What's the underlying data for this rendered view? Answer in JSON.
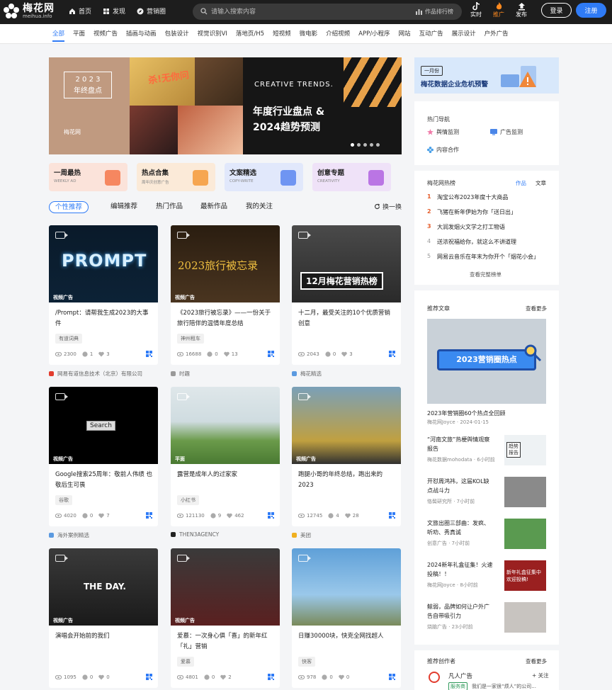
{
  "header": {
    "logo_cn": "梅花网",
    "logo_en": "meihua.info",
    "nav": [
      {
        "label": "首页",
        "icon": "home-icon"
      },
      {
        "label": "发现",
        "icon": "grid-icon"
      },
      {
        "label": "营销圈",
        "icon": "compass-icon"
      }
    ],
    "search_placeholder": "请输入搜索内容",
    "rank_label": "作品排行榜",
    "actions": [
      {
        "label": "实时",
        "icon": "tiktok-icon"
      },
      {
        "label": "推广",
        "icon": "flame-icon"
      },
      {
        "label": "发布",
        "icon": "upload-icon"
      }
    ],
    "login_label": "登录",
    "register_label": "注册"
  },
  "categories": [
    "全部",
    "平面",
    "视频广告",
    "插画与动画",
    "包装设计",
    "视觉识别VI",
    "落地页/H5",
    "短视频",
    "微电影",
    "介绍视频",
    "APP/小程序",
    "网站",
    "互动广告",
    "展示设计",
    "户外广告"
  ],
  "banner": {
    "year_box_line1": "2 0 2 3",
    "year_box_line2": "年终盘点",
    "brand_mini": "梅花网",
    "slogan": "杀!无你问",
    "trend": "CREATIVE TRENDS.",
    "headline_line1": "年度行业盘点 &",
    "headline_line2": "2024趋势预测",
    "slides": 5,
    "active_slide": 1
  },
  "quicklinks": [
    {
      "title": "一周最热",
      "sub": "WEEKLY AD",
      "bg": "#fbe3da",
      "icon": "#f5774a"
    },
    {
      "title": "热点合集",
      "sub": "周年庆创意广告",
      "bg": "#fbead8",
      "icon": "#f59a3a"
    },
    {
      "title": "文案精选",
      "sub": "COPY-WRITE",
      "bg": "#e1e8fb",
      "icon": "#5b86f0"
    },
    {
      "title": "创意专题",
      "sub": "CREATIVITY",
      "bg": "#efe2f8",
      "icon": "#b061e0"
    }
  ],
  "feed_tabs": [
    "个性推荐",
    "编辑推荐",
    "热门作品",
    "最新作品",
    "我的关注"
  ],
  "refresh_label": "换一换",
  "cards": [
    {
      "tag": "视频广告",
      "title": "/Prompt：请帮我生成2023的大事件",
      "label": "有道词典",
      "views": "2300",
      "comments": "1",
      "likes": "3",
      "author": "网易有道信息技术（北京）有限公司",
      "thumb_text": "PROMPT",
      "bg": "linear-gradient(180deg,#0a1a2a,#0c2236)"
    },
    {
      "tag": "视频广告",
      "title": "《2023旅行被忘录》——一份关于旅行陪伴的温情年度总结",
      "label": "神州租车",
      "views": "16688",
      "comments": "0",
      "likes": "13",
      "author": "时趣",
      "thumb_text": "2023旅行被忘录",
      "bg": "linear-gradient(180deg,#2a1d10,#4a3520)"
    },
    {
      "tag": "",
      "title": "十二月，最受关注的10个优质营销创意",
      "label": "",
      "views": "2043",
      "comments": "0",
      "likes": "3",
      "author": "梅花精选",
      "thumb_text": "12月梅花营销热榜",
      "bg": "linear-gradient(180deg,#4a4a4a,#2a2a2a)"
    },
    {
      "tag": "视频广告",
      "title": "Google搜索25周年：敬前人伟绩 也敬后生可畏",
      "label": "谷歌",
      "views": "4020",
      "comments": "0",
      "likes": "7",
      "author": "海外案例精选",
      "thumb_text": "Search",
      "bg": "#000000"
    },
    {
      "tag": "平面",
      "title": "露营是成年人的过家家",
      "label": "小红书",
      "views": "121130",
      "comments": "9",
      "likes": "462",
      "author": "THEN3AGENCY",
      "thumb_text": "",
      "bg": "linear-gradient(180deg,#dfe7ea 0%,#cfdce0 45%,#6a9a4a 70%,#4a7a32 100%)"
    },
    {
      "tag": "视频广告",
      "title": "跑腿小哥的年终总结，跑出来的2023",
      "label": "",
      "views": "12745",
      "comments": "4",
      "likes": "28",
      "author": "美团",
      "thumb_text": "",
      "bg": "linear-gradient(180deg,#7aa0b8,#c0a040 70%,#303030)"
    },
    {
      "tag": "视频广告",
      "title": "演唱会开始前的我们",
      "label": "",
      "views": "1095",
      "comments": "0",
      "likes": "0",
      "author": "",
      "thumb_text": "THE DAY.",
      "bg": "linear-gradient(180deg,#3a3a3a,#1a1a1a)"
    },
    {
      "tag": "视频广告",
      "title": "爱慕：一次身心俱「喜」的新年红「礼」营销",
      "label": "爱慕",
      "views": "4801",
      "comments": "0",
      "likes": "2",
      "author": "",
      "thumb_text": "",
      "bg": "linear-gradient(180deg,#3a3a3a,#5a2020)"
    },
    {
      "tag": "",
      "title": "日赚30000块，快克全网找超人",
      "label": "快客",
      "views": "978",
      "comments": "0",
      "likes": "0",
      "author": "",
      "thumb_text": "",
      "bg": "linear-gradient(180deg,#5fa0d8,#9ac8ea 60%,#7a8a5a)"
    }
  ],
  "sidebar": {
    "ad_pill": "一月份",
    "ad_title": "梅花数据企业危机预警",
    "hotnav_title": "热门导航",
    "hotnav": [
      {
        "label": "舆情监测",
        "icon": "star-icon"
      },
      {
        "label": "广告监测",
        "icon": "monitor-icon"
      },
      {
        "label": "内容合作",
        "icon": "flower-icon"
      }
    ],
    "rank_title": "梅花网热榜",
    "rank_tab_active": "作品",
    "rank_tab_other": "文章",
    "rank": [
      {
        "n": "1",
        "title": "淘宝公布2023年度十大商品"
      },
      {
        "n": "2",
        "title": "飞猪在新年伊始为你「送日出」"
      },
      {
        "n": "3",
        "title": "大润发烟火文学之打工物语"
      },
      {
        "n": "4",
        "title": "送浓祝福给你，就这么不讲道理"
      },
      {
        "n": "5",
        "title": "网易云音乐在年末为你开个「烟花小会」"
      }
    ],
    "rank_more": "查看完整榜单",
    "rec_title": "推荐文章",
    "rec_more": "查看更多",
    "feature_text": "2023营销圈热点",
    "feature_caption": "2023年营销圈60个热点全回顾",
    "feature_meta": "梅花网Joyce · 2024-01-15",
    "articles": [
      {
        "title": "“河南文旅”热梗舆情观察报告",
        "meta": "梅花数据mohodata · 6小时前",
        "img": "#eef2f4"
      },
      {
        "title": "开怼周鸿祎，这届KOL缺点战斗力",
        "meta": "恪鬓研究所 · 7小时前",
        "img": "#8a8a8a"
      },
      {
        "title": "文旅出圈三部曲：发疯、听劝、秀真诚",
        "meta": "创意广告 · 7小时前",
        "img": "#5a9a50"
      },
      {
        "title": "2024新年礼盒征集！火速投稿！！",
        "meta": "梅花网Joyce · 8小时前",
        "img": "#9a2020"
      },
      {
        "title": "鲸弱，品牌如何让户外广告自带吸引力",
        "meta": "烧脑广告 · 23小时前",
        "img": "#c8c4c0"
      }
    ],
    "art_img_text_1": "趋势报告",
    "art_img_text_4": "新年礼盒征集中 欢迎投稿!",
    "creator_title": "推荐创作者",
    "creator_more": "查看更多",
    "creator_name": "凡人广告",
    "creator_follow": "+ 关注",
    "creator_badge": "服务商",
    "creator_desc": "我们是一家很“烦人”的公司..."
  }
}
